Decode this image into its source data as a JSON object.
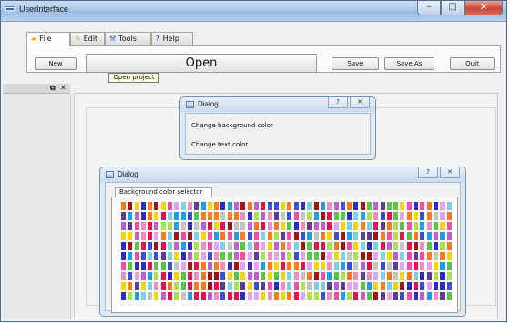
{
  "window": {
    "title": "UserInterface",
    "buttons": {
      "minimize": "–",
      "maximize": "□",
      "close": "✕"
    }
  },
  "tabs": [
    {
      "label": "File",
      "icon": "folder-icon"
    },
    {
      "label": "Edit",
      "icon": "pencil-icon"
    },
    {
      "label": "Tools",
      "icon": "tools-icon"
    },
    {
      "label": "Help",
      "icon": "help-icon"
    }
  ],
  "toolbar": {
    "new": "New",
    "open": "Open",
    "save": "Save",
    "save_as": "Save As",
    "quit": "Quit"
  },
  "tooltip": {
    "open": "Open project"
  },
  "dock": {
    "float": "⧉",
    "close": "✕"
  },
  "dialog1": {
    "title": "Dialog",
    "help": "?",
    "close": "✕",
    "items": [
      "Change background color",
      "Change text color"
    ]
  },
  "dialog2": {
    "title": "Dialog",
    "help": "?",
    "close": "✕",
    "group_tab": "Background color selector",
    "swatch_colors": [
      "#e8114f",
      "#f5d40c",
      "#c05ecf",
      "#2d2ac6",
      "#ee8ebc",
      "#58c448",
      "#7bd0e8",
      "#ff7a1f",
      "#a51212",
      "#e5a2f0",
      "#1f9ee8",
      "#a9e24a",
      "#5f3b99",
      "#c4c4c4",
      "#f74ba6",
      "#3b4fd6"
    ]
  }
}
